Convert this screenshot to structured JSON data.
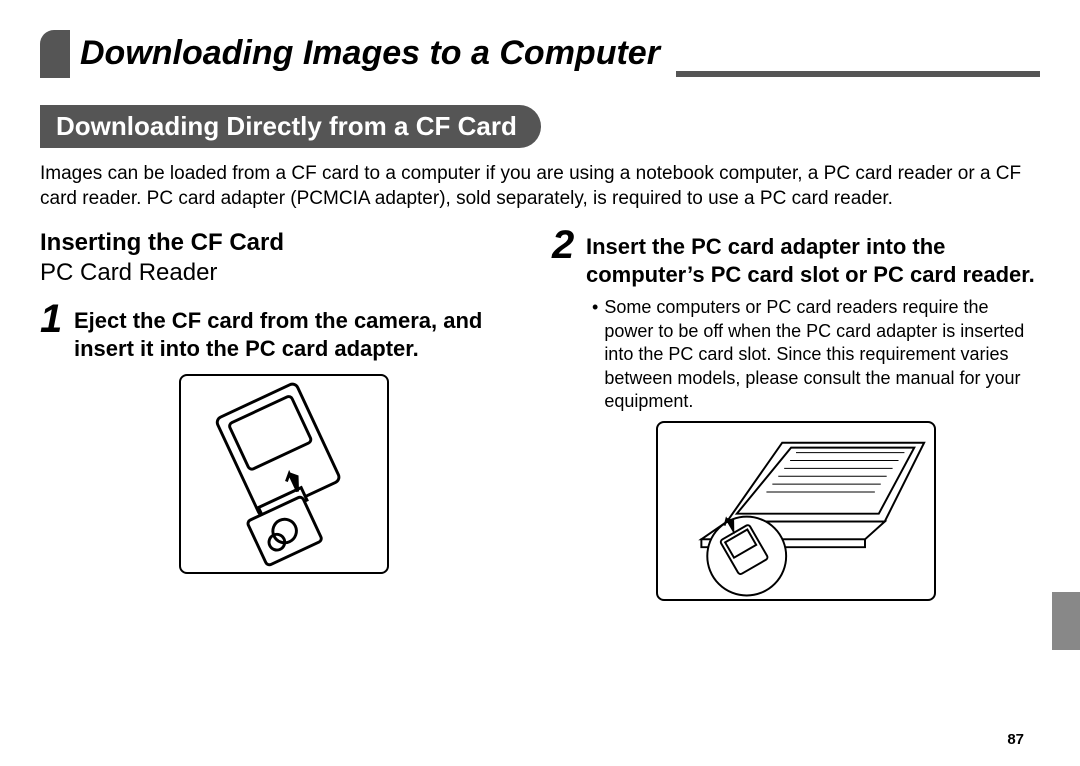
{
  "chapter": {
    "title": "Downloading Images to a Computer"
  },
  "section": {
    "title": "Downloading Directly from a CF Card"
  },
  "intro": "Images can be loaded from a CF card to a computer if you are using a notebook computer, a PC card reader or a CF card reader. PC card adapter (PCMCIA adapter), sold separately, is required to use a PC card reader.",
  "left": {
    "heading": "Inserting the CF Card",
    "subheading": "PC Card Reader",
    "step1": {
      "num": "1",
      "title": "Eject the CF card from the camera, and insert it into the PC card adapter."
    }
  },
  "right": {
    "step2": {
      "num": "2",
      "title": "Insert the PC card adapter into the computer’s PC card slot or PC card reader.",
      "note": "Some computers or PC card readers require the power to be off when the PC card adapter is inserted into the PC card slot. Since this requirement varies between models, please consult the manual for your equipment."
    }
  },
  "page_number": "87"
}
